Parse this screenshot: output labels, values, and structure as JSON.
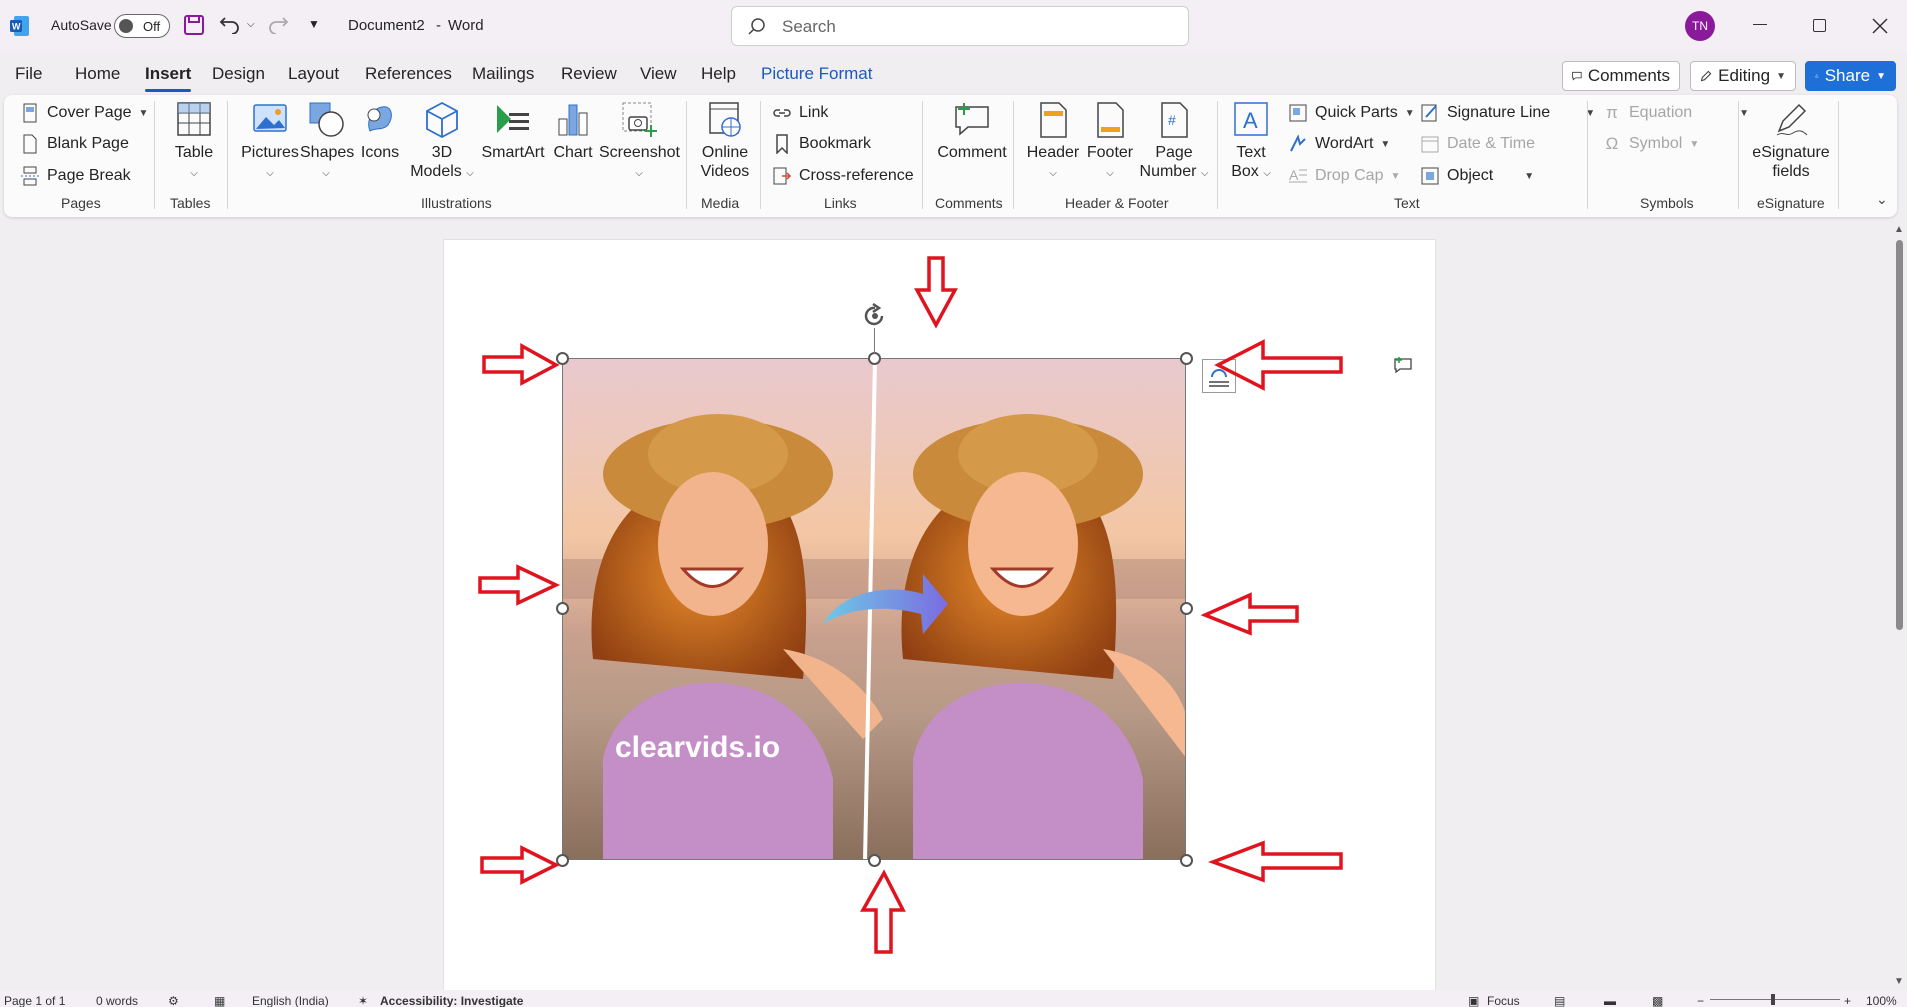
{
  "titlebar": {
    "autosave_label": "AutoSave",
    "autosave_state": "Off",
    "doc_title": "Document2",
    "sep": "-",
    "app_name": "Word",
    "search_placeholder": "Search",
    "avatar_initials": "TN"
  },
  "menu": {
    "tabs": [
      "File",
      "Home",
      "Insert",
      "Design",
      "Layout",
      "References",
      "Mailings",
      "Review",
      "View",
      "Help",
      "Picture Format"
    ],
    "active": "Insert",
    "comments_label": "Comments",
    "editing_label": "Editing",
    "share_label": "Share"
  },
  "ribbon": {
    "pages": {
      "cover_page": "Cover Page",
      "blank_page": "Blank Page",
      "page_break": "Page Break",
      "label": "Pages"
    },
    "tables": {
      "table": "Table",
      "label": "Tables"
    },
    "illustrations": {
      "pictures": "Pictures",
      "shapes": "Shapes",
      "icons": "Icons",
      "models_1": "3D",
      "models_2": "Models",
      "smartart": "SmartArt",
      "chart": "Chart",
      "screenshot": "Screenshot",
      "label": "Illustrations"
    },
    "media": {
      "online_1": "Online",
      "online_2": "Videos",
      "label": "Media"
    },
    "links": {
      "link": "Link",
      "bookmark": "Bookmark",
      "crossref": "Cross-reference",
      "label": "Links"
    },
    "comments": {
      "comment": "Comment",
      "label": "Comments"
    },
    "header_footer": {
      "header": "Header",
      "footer": "Footer",
      "page_1": "Page",
      "page_2": "Number",
      "label": "Header & Footer"
    },
    "text": {
      "textbox_1": "Text",
      "textbox_2": "Box",
      "quick_parts": "Quick Parts",
      "wordart": "WordArt",
      "drop_cap": "Drop Cap",
      "signature_line": "Signature Line",
      "date_time": "Date & Time",
      "object": "Object",
      "label": "Text"
    },
    "symbols": {
      "equation": "Equation",
      "symbol": "Symbol",
      "label": "Symbols"
    },
    "esignature": {
      "fields_1": "eSignature",
      "fields_2": "fields",
      "label": "eSignature"
    }
  },
  "document": {
    "watermark_text": "clearvids.io"
  },
  "status": {
    "page": "Page 1 of 1",
    "words": "0 words",
    "language": "English (India)",
    "accessibility": "Accessibility: Investigate",
    "focus": "Focus",
    "zoom": "100%"
  },
  "colors": {
    "accent": "#185abd",
    "share": "#1f6fd8",
    "avatar": "#8a1a9b",
    "arrows": "#e0141e"
  }
}
